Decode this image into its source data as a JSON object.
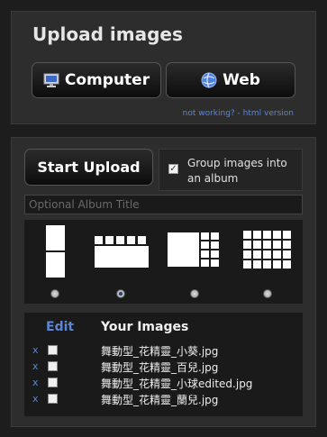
{
  "upload_panel": {
    "title": "Upload images",
    "computer_label": "Computer",
    "web_label": "Web",
    "fallback_link": "not working? - html version"
  },
  "controls": {
    "start_label": "Start Upload",
    "group_label": "Group images into an album",
    "group_checked": true,
    "album_placeholder": "Optional Album Title"
  },
  "layouts": {
    "options": [
      "single-column",
      "wide-strip",
      "large-with-grid",
      "grid"
    ],
    "selected": "wide-strip"
  },
  "images": {
    "edit_label": "Edit",
    "header": "Your Images",
    "remove_symbol": "x",
    "files": [
      "舞動型_花精靈_小葵.jpg",
      "舞動型_花精靈_百兒.jpg",
      "舞動型_花精靈_小球edited.jpg",
      "舞動型_花精靈_蘭兒.jpg"
    ]
  },
  "colors": {
    "background": "#1d1d1d",
    "panel": "#2d2d2d",
    "link": "#5b86d6"
  }
}
